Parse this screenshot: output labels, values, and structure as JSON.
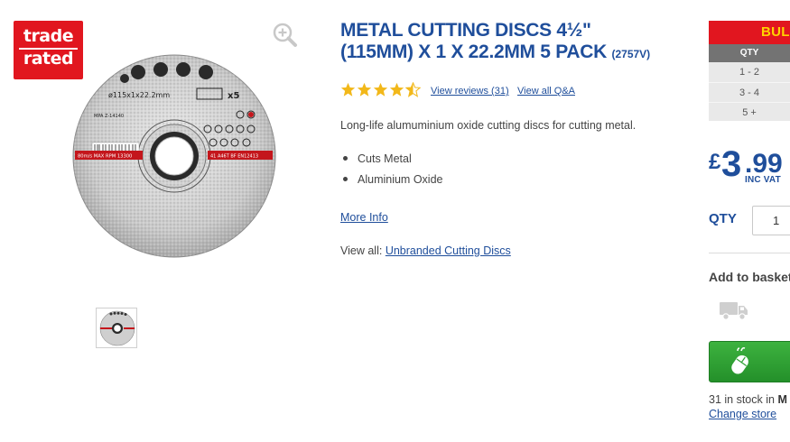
{
  "badge": {
    "line1": "trade",
    "line2": "rated"
  },
  "product": {
    "title": "METAL CUTTING DISCS 4½\" (115MM) X 1 X 22.2MM 5 PACK",
    "code": "(2757V)",
    "rating": 4.5,
    "reviews_link": "View reviews (31)",
    "qa_link": "View all Q&A",
    "description": "Long-life alumuminium oxide cutting discs for cutting metal.",
    "features": [
      "Cuts Metal",
      "Aluminium Oxide"
    ],
    "more_info": "More Info",
    "view_all_prefix": "View all:",
    "view_all_link": "Unbranded Cutting Discs"
  },
  "disc_print": {
    "size": "ø115x1x22.2mm",
    "pack": "x5",
    "mpa": "MPA Z-14140",
    "speed": "80m/s MAX RPM 13300",
    "standard": "41 A46T BF EN12413",
    "barcode": "5 0 663 62 8 11 08 4 3"
  },
  "bulk": {
    "header": "BULK",
    "qty_header": "QTY",
    "rows": [
      "1 - 2",
      "3 - 4",
      "5 +"
    ]
  },
  "price": {
    "currency": "£",
    "pounds": "3",
    "pence": ".99",
    "vat": "INC VAT"
  },
  "qty": {
    "label": "QTY",
    "value": "1"
  },
  "basket": {
    "label": "Add to basket"
  },
  "stock": {
    "text": "31 in stock in",
    "store": "M",
    "change": "Change store"
  },
  "colors": {
    "brand_red": "#e1161f",
    "brand_blue": "#1f4e9b",
    "cta_green": "#2ea134",
    "star": "#f2b81a"
  },
  "icons": [
    "zoom-in-icon",
    "star-icon",
    "delivery-van-icon",
    "mouse-click-icon"
  ]
}
